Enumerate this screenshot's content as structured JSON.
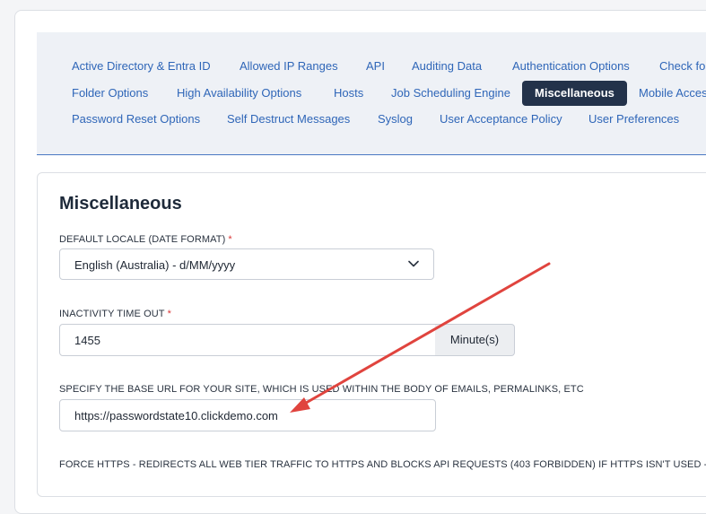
{
  "tabs": [
    "Active Directory & Entra ID",
    "Allowed IP Ranges",
    "API",
    "Auditing Data",
    "Authentication Options",
    "Check for",
    "Folder Options",
    "High Availability Options",
    "Hosts",
    "Job Scheduling Engine",
    "Miscellaneous",
    "Mobile Acces",
    "Password Reset Options",
    "Self Destruct Messages",
    "Syslog",
    "User Acceptance Policy",
    "User Preferences"
  ],
  "active_tab": "Miscellaneous",
  "section": {
    "title": "Miscellaneous"
  },
  "fields": {
    "locale": {
      "label": "DEFAULT LOCALE (DATE FORMAT)",
      "required_mark": "*",
      "value": "English (Australia) - d/MM/yyyy"
    },
    "inactivity": {
      "label": "INACTIVITY TIME OUT",
      "required_mark": "*",
      "value": "1455",
      "unit": "Minute(s)"
    },
    "base_url": {
      "label": "SPECIFY THE BASE URL FOR YOUR SITE, WHICH IS USED WITHIN THE BODY OF EMAILS, PERMALINKS, ETC",
      "value": "https://passwordstate10.clickdemo.com"
    },
    "force_https": {
      "label": "FORCE HTTPS - REDIRECTS ALL WEB TIER TRAFFIC TO HTTPS AND BLOCKS API REQUESTS (403 FORBIDDEN) IF HTTPS ISN'T USED -"
    }
  },
  "colors": {
    "tab_text": "#2f66b8",
    "active_tab_bg": "#23324a",
    "required": "#d93636",
    "annotation_arrow": "#e0443e"
  },
  "icons": {
    "select_chevron": "chevron-down-icon",
    "annotation": "arrow-annotation-icon"
  }
}
